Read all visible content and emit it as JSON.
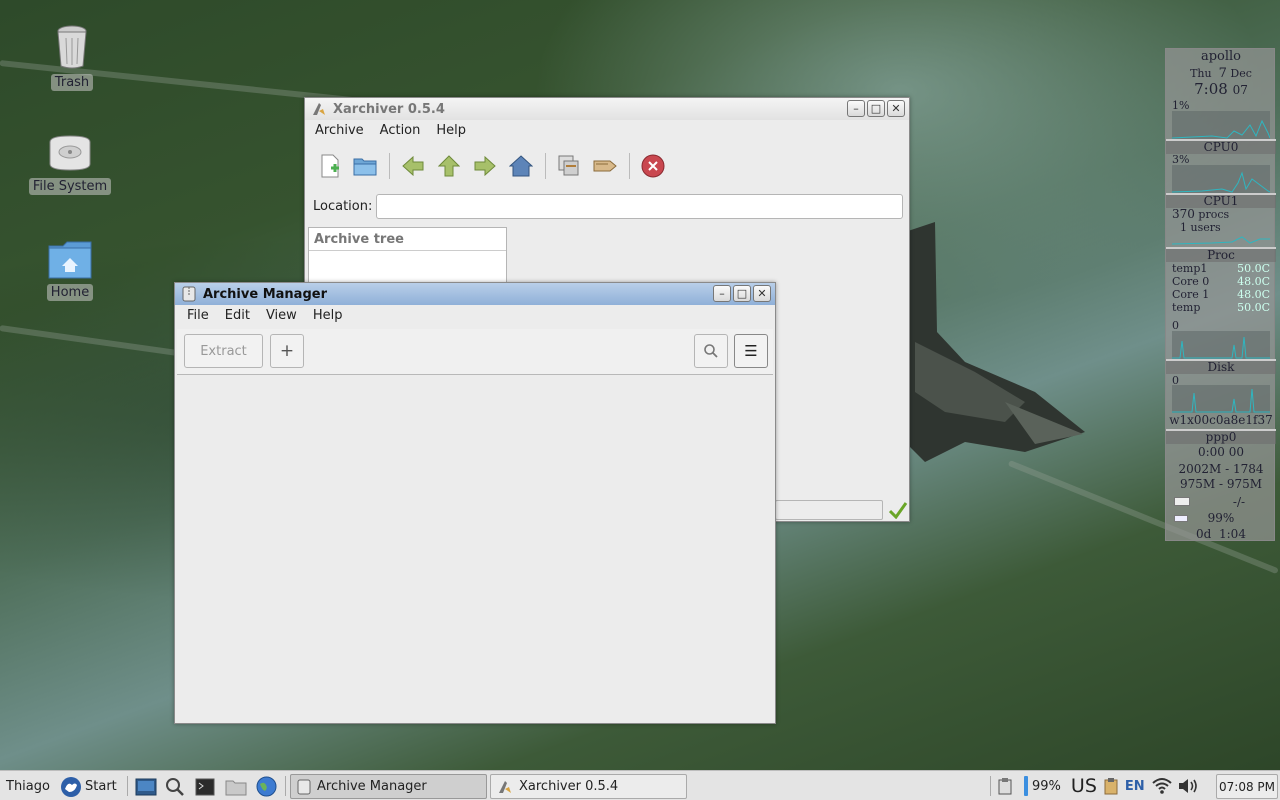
{
  "desktop": {
    "icons": [
      {
        "label": "Trash",
        "icon": "trash-icon"
      },
      {
        "label": "File System",
        "icon": "drive-icon"
      },
      {
        "label": "Home",
        "icon": "home-folder-icon"
      }
    ]
  },
  "conky": {
    "hostname": "apollo",
    "day": "Thu",
    "date_num": "7",
    "month": "Dec",
    "time": "7:08",
    "seconds": "07",
    "cpu0_pct": "1%",
    "cpu0_label": "CPU0",
    "cpu1_pct": "3%",
    "cpu1_label": "CPU1",
    "procs_count": "370",
    "procs_label": "procs",
    "users_count": "1",
    "users_label": "users",
    "proc_label": "Proc",
    "temps": [
      {
        "name": "temp1",
        "value": "50.0C"
      },
      {
        "name": "Core 0",
        "value": "48.0C"
      },
      {
        "name": "Core 1",
        "value": "48.0C"
      },
      {
        "name": "temp",
        "value": "50.0C"
      }
    ],
    "proc_graph_val": "0",
    "disk_label": "Disk",
    "disk_graph_val": "0",
    "iface_id": "w1x00c0a8e1f37",
    "ppp_label": "ppp0",
    "uptime_net": "0:00",
    "uptime_net_unit": "00",
    "mem1": "2002M - 1784",
    "mem2": "975M - 975M",
    "mail": "-/-",
    "battery": "99%",
    "uptime": "0d",
    "uptime_hm": "1:04"
  },
  "xarchiver": {
    "title": "Xarchiver 0.5.4",
    "menu": [
      "Archive",
      "Action",
      "Help"
    ],
    "location_label": "Location:",
    "location_value": "",
    "archive_tree_header": "Archive tree"
  },
  "archive_manager": {
    "title": "Archive Manager",
    "menu": [
      "File",
      "Edit",
      "View",
      "Help"
    ],
    "extract_label": "Extract",
    "add_label": "+",
    "menu_glyph": "☰"
  },
  "taskbar": {
    "user": "Thiago",
    "start": "Start",
    "tasks": [
      {
        "label": "Archive Manager",
        "active": true
      },
      {
        "label": "Xarchiver 0.5.4",
        "active": false
      }
    ],
    "battery_pct": "99%",
    "keyboard_layout": "US",
    "lang": "EN",
    "clock": "07:08 PM"
  },
  "colors": {
    "am_titlebar": "#8fb0d8",
    "conky_value": "#cceeff",
    "taskbar_bg": "#e4e4e4"
  }
}
